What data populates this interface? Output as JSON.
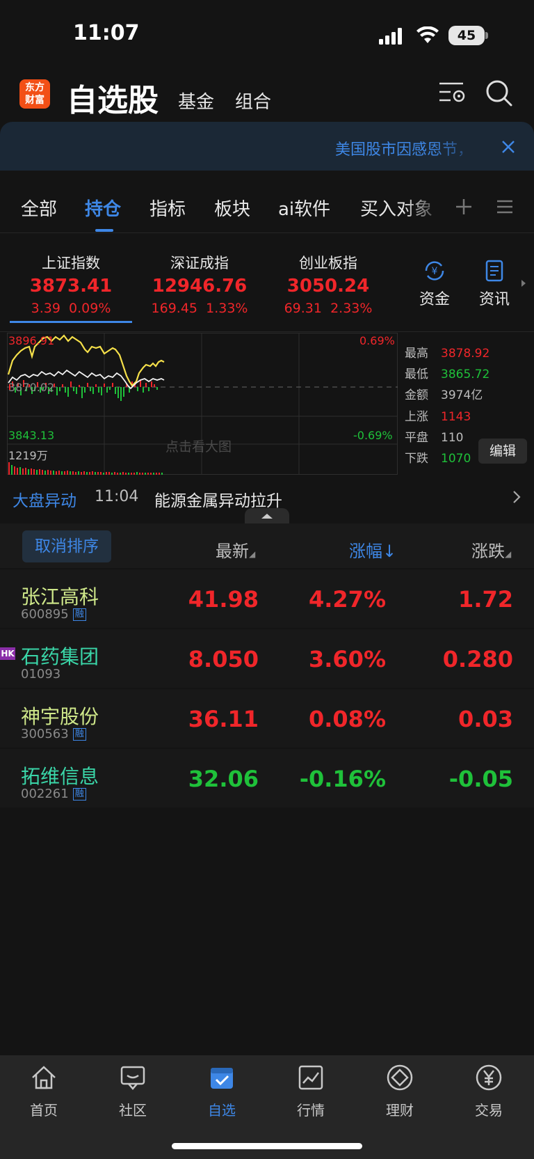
{
  "status": {
    "time": "11:07",
    "battery": "45"
  },
  "header": {
    "logo_line1": "东方",
    "logo_line2": "财富",
    "title": "自选股",
    "tabs": [
      "基金",
      "组合"
    ]
  },
  "banner": {
    "text": "美国股市因感恩节，"
  },
  "categories": {
    "tabs": [
      "全部",
      "持仓",
      "指标",
      "板块",
      "ai软件",
      "买入对象"
    ],
    "active": "持仓"
  },
  "indices": [
    {
      "name": "上证指数",
      "value": "3873.41",
      "change": "3.39",
      "pct": "0.09%"
    },
    {
      "name": "深证成指",
      "value": "12946.76",
      "change": "169.45",
      "pct": "1.33%"
    },
    {
      "name": "创业板指",
      "value": "3050.24",
      "change": "69.31",
      "pct": "2.33%"
    }
  ],
  "side_buttons": {
    "funds": "资金",
    "news": "资讯"
  },
  "chart": {
    "high_label": "3896.91",
    "mid_label": "3870.02",
    "low_label": "3843.13",
    "pct_high": "0.69%",
    "pct_low": "-0.69%",
    "volume": "1219万",
    "hint": "点击看大图"
  },
  "stats": {
    "high": {
      "k": "最高",
      "v": "3878.92"
    },
    "low": {
      "k": "最低",
      "v": "3865.72"
    },
    "amount": {
      "k": "金额",
      "v": "3974亿"
    },
    "up": {
      "k": "上涨",
      "v": "1143"
    },
    "flat": {
      "k": "平盘",
      "v": "110"
    },
    "down": {
      "k": "下跌",
      "v": "1070"
    },
    "edit": "编辑"
  },
  "alert": {
    "tag": "大盘异动",
    "time": "11:04",
    "text": "能源金属异动拉升"
  },
  "list_header": {
    "sort": "取消排序",
    "latest": "最新",
    "change_pct": "涨幅↓",
    "change": "涨跌"
  },
  "stocks": [
    {
      "name": "张江高科",
      "code": "600895",
      "rong": "融",
      "price": "41.98",
      "pct": "4.27%",
      "chg": "1.72",
      "dir": "up"
    },
    {
      "name": "石药集团",
      "code": "01093",
      "hk": "HK",
      "price": "8.050",
      "pct": "3.60%",
      "chg": "0.280",
      "dir": "up"
    },
    {
      "name": "神宇股份",
      "code": "300563",
      "rong": "融",
      "price": "36.11",
      "pct": "0.08%",
      "chg": "0.03",
      "dir": "up"
    },
    {
      "name": "拓维信息",
      "code": "002261",
      "rong": "融",
      "price": "32.06",
      "pct": "-0.16%",
      "chg": "-0.05",
      "dir": "down"
    }
  ],
  "nav": [
    "首页",
    "社区",
    "自选",
    "行情",
    "理财",
    "交易"
  ],
  "nav_active": "自选",
  "colors": {
    "up": "#f0262a",
    "down": "#1fc13a",
    "accent": "#3e87e6"
  }
}
